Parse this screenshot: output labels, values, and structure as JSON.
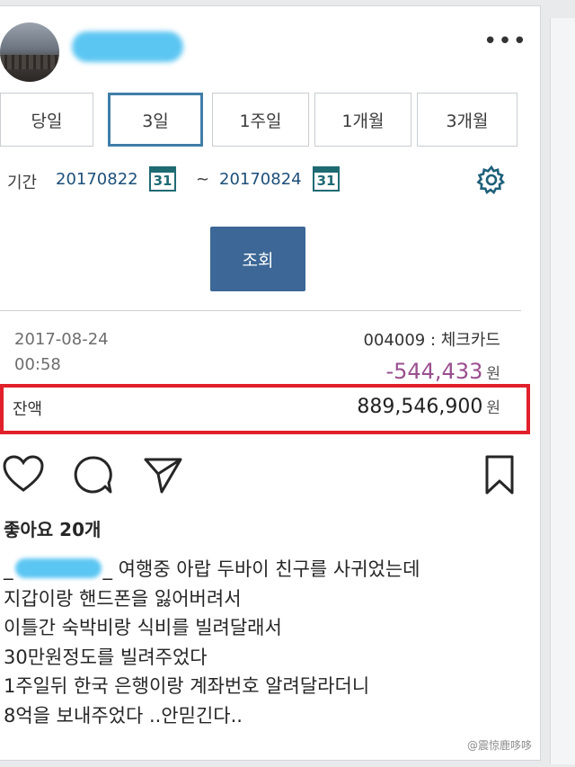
{
  "header": {
    "menu_label": "•••"
  },
  "bank": {
    "periods": [
      {
        "label": "당일",
        "active": false
      },
      {
        "label": "3일",
        "active": true
      },
      {
        "label": "1주일",
        "active": false
      },
      {
        "label": "1개월",
        "active": false
      },
      {
        "label": "3개월",
        "active": false
      }
    ],
    "period_label": "기간",
    "start_date": "20170822",
    "end_date": "20170824",
    "calendar_day": "31",
    "range_separator": "~",
    "query_button": "조회",
    "transaction": {
      "date": "2017-08-24",
      "time": "00:58",
      "card": "004009 : 체크카드",
      "amount": "-544,433",
      "currency": "원"
    },
    "balance": {
      "label": "잔액",
      "amount": "889,546,900",
      "currency": "원"
    },
    "colors": {
      "active_border": "#3f7ea8",
      "query_button": "#3c6796",
      "amount": "#9a4f8f",
      "highlight_box": "#e0202a"
    }
  },
  "post": {
    "likes": "좋아요 20개",
    "caption": {
      "line1_prefix": "_",
      "line1_after_mention": "_ 여행중 아랍 두바이 친구를 사귀었는데",
      "line2": "지갑이랑 핸드폰을 잃어버려서",
      "line3": "이틀간 숙박비랑 식비를 빌려달래서",
      "line4": "30만원정도를 빌려주었다",
      "line5": "1주일뒤 한국 은행이랑 계좌번호 알려달라더니",
      "line6": "8억을 보내주었다 ..안믿긴다.."
    },
    "icons": [
      "heart-icon",
      "comment-icon",
      "share-icon",
      "bookmark-icon"
    ]
  },
  "watermark": "@震惊鹿哆哆"
}
